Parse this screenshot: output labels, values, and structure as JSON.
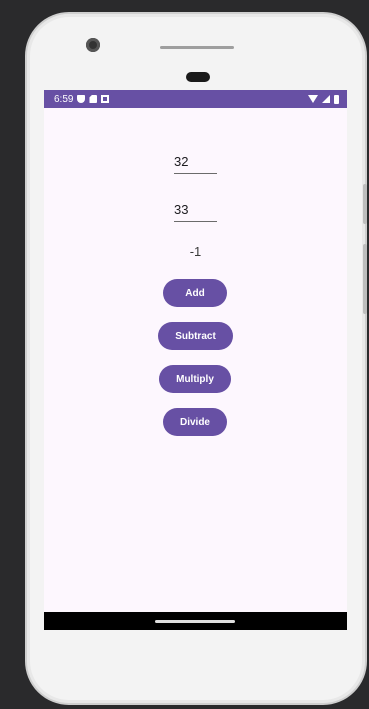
{
  "status_bar": {
    "time": "6:59",
    "icons_left": [
      "shield-icon",
      "sd-card-icon",
      "photo-icon"
    ],
    "icons_right": [
      "wifi-icon",
      "signal-icon",
      "battery-icon"
    ],
    "color": "#6750a4"
  },
  "inputs": {
    "first_value": "32",
    "second_value": "33"
  },
  "result": "-1",
  "buttons": {
    "add": "Add",
    "subtract": "Subtract",
    "multiply": "Multiply",
    "divide": "Divide"
  },
  "colors": {
    "accent": "#6750a4",
    "background": "#fdf7fe"
  }
}
